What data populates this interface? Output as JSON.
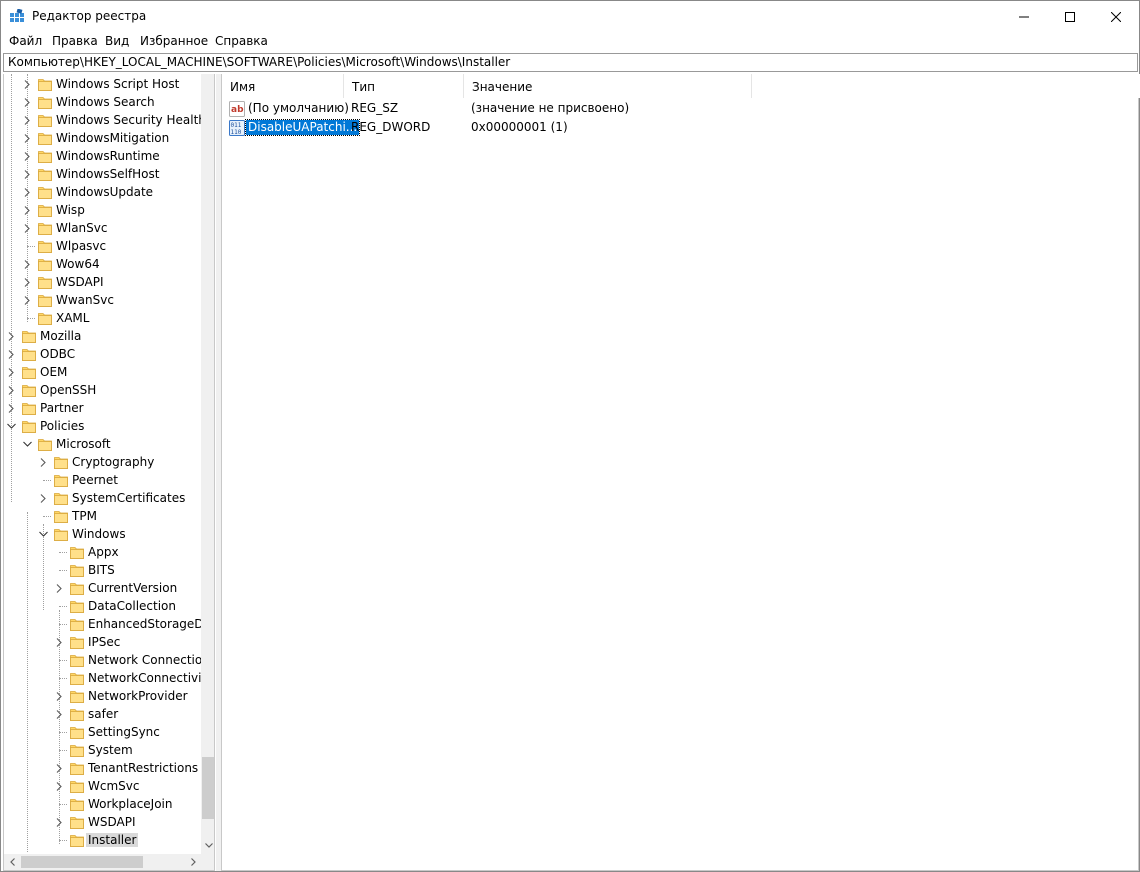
{
  "window": {
    "title": "Редактор реестра"
  },
  "menu": [
    "Файл",
    "Правка",
    "Вид",
    "Избранное",
    "Справка"
  ],
  "address": "Компьютер\\HKEY_LOCAL_MACHINE\\SOFTWARE\\Policies\\Microsoft\\Windows\\Installer",
  "tree": {
    "items": [
      {
        "label": "Windows Script Host",
        "expander": "collapsed"
      },
      {
        "label": "Windows Search",
        "expander": "collapsed"
      },
      {
        "label": "Windows Security Health",
        "expander": "collapsed"
      },
      {
        "label": "WindowsMitigation",
        "expander": "collapsed"
      },
      {
        "label": "WindowsRuntime",
        "expander": "collapsed"
      },
      {
        "label": "WindowsSelfHost",
        "expander": "collapsed"
      },
      {
        "label": "WindowsUpdate",
        "expander": "collapsed"
      },
      {
        "label": "Wisp",
        "expander": "collapsed"
      },
      {
        "label": "WlanSvc",
        "expander": "collapsed"
      },
      {
        "label": "Wlpasvc",
        "expander": "none"
      },
      {
        "label": "Wow64",
        "expander": "collapsed"
      },
      {
        "label": "WSDAPI",
        "expander": "collapsed"
      },
      {
        "label": "WwanSvc",
        "expander": "collapsed"
      },
      {
        "label": "XAML",
        "expander": "none"
      },
      {
        "label": "Mozilla",
        "expander": "collapsed"
      },
      {
        "label": "ODBC",
        "expander": "collapsed"
      },
      {
        "label": "OEM",
        "expander": "collapsed"
      },
      {
        "label": "OpenSSH",
        "expander": "collapsed"
      },
      {
        "label": "Partner",
        "expander": "collapsed"
      },
      {
        "label": "Policies",
        "expander": "expanded"
      },
      {
        "label": "Microsoft",
        "expander": "expanded"
      },
      {
        "label": "Cryptography",
        "expander": "collapsed"
      },
      {
        "label": "Peernet",
        "expander": "none"
      },
      {
        "label": "SystemCertificates",
        "expander": "collapsed"
      },
      {
        "label": "TPM",
        "expander": "none"
      },
      {
        "label": "Windows",
        "expander": "expanded"
      },
      {
        "label": "Appx",
        "expander": "none"
      },
      {
        "label": "BITS",
        "expander": "none"
      },
      {
        "label": "CurrentVersion",
        "expander": "collapsed"
      },
      {
        "label": "DataCollection",
        "expander": "none"
      },
      {
        "label": "EnhancedStorageDev",
        "expander": "none"
      },
      {
        "label": "IPSec",
        "expander": "collapsed"
      },
      {
        "label": "Network Connections",
        "expander": "none"
      },
      {
        "label": "NetworkConnectivity",
        "expander": "none"
      },
      {
        "label": "NetworkProvider",
        "expander": "collapsed"
      },
      {
        "label": "safer",
        "expander": "collapsed"
      },
      {
        "label": "SettingSync",
        "expander": "none"
      },
      {
        "label": "System",
        "expander": "none"
      },
      {
        "label": "TenantRestrictions",
        "expander": "collapsed"
      },
      {
        "label": "WcmSvc",
        "expander": "collapsed"
      },
      {
        "label": "WorkplaceJoin",
        "expander": "none"
      },
      {
        "label": "WSDAPI",
        "expander": "collapsed"
      },
      {
        "label": "Installer",
        "expander": "none",
        "selected": true
      }
    ]
  },
  "list": {
    "columns": [
      "Имя",
      "Тип",
      "Значение"
    ],
    "rows": [
      {
        "name": "(По умолчанию)",
        "type": "REG_SZ",
        "data": "(значение не присвоено)",
        "icon": "string-value-icon"
      },
      {
        "name": "DisableUAPatchi...",
        "type": "REG_DWORD",
        "data": "0x00000001 (1)",
        "icon": "binary-value-icon",
        "selected": true
      }
    ]
  },
  "colors": {
    "selection": "#0078d7",
    "folder": "#ffd766",
    "tree_selection": "#d9d9d9"
  }
}
